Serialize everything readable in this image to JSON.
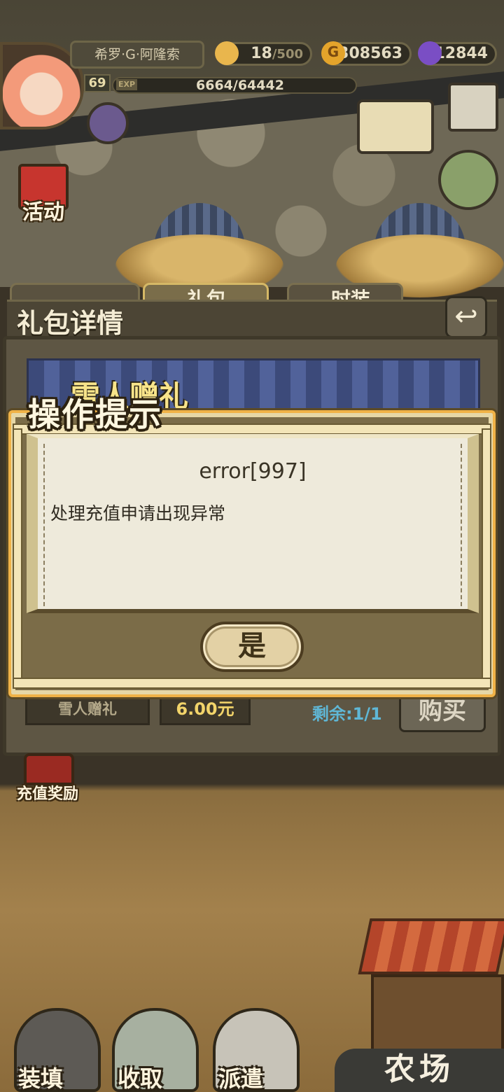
{
  "hud": {
    "player_name": "希罗·G·阿隆索",
    "level": "69",
    "exp_label": "EXP",
    "exp_value": "6664/64442",
    "stamina_current": "18",
    "stamina_max": "/500",
    "gold": "308563",
    "gems": "12844"
  },
  "side": {
    "event_label": "活动",
    "recharge_label": "充值奖励"
  },
  "panel": {
    "title": "礼包详情",
    "tabs": [
      "礼包",
      "时装"
    ],
    "banner_title": "雪人赠礼",
    "item_name": "雪人赠礼",
    "price": "6.00元",
    "remaining": "剩余:1/1",
    "buy_label": "购买"
  },
  "dialog": {
    "title": "操作提示",
    "error_code": "error[997]",
    "message": "处理充值申请出现异常",
    "confirm_label": "是"
  },
  "bottom": {
    "btn1": "装填",
    "btn2": "收取",
    "btn3": "派遣",
    "farm": "农场"
  },
  "colors": {
    "dialog_border": "#f0b247",
    "paper": "#eeeadb",
    "price_text": "#f2d46a",
    "remaining_text": "#5fb7d6"
  }
}
